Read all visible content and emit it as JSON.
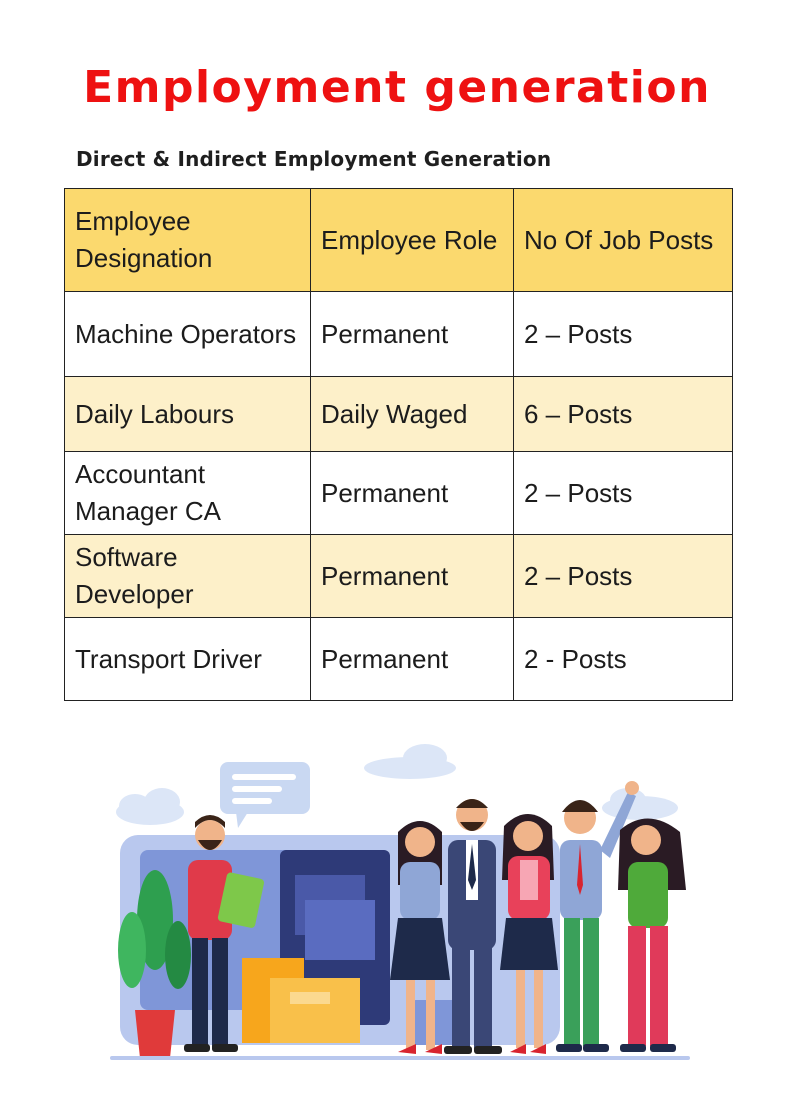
{
  "title": "Employment generation",
  "subtitle": "Direct & Indirect Employment Generation",
  "table": {
    "headers": [
      "Employee Designation",
      "Employee Role",
      "No Of Job Posts"
    ],
    "rows": [
      [
        "Machine Operators",
        "Permanent",
        "2 – Posts"
      ],
      [
        "Daily Labours",
        "Daily Waged",
        "6 – Posts"
      ],
      [
        "Accountant Manager CA",
        "Permanent",
        "2 – Posts"
      ],
      [
        "Software Developer",
        "Permanent",
        "2 – Posts"
      ],
      [
        "Transport Driver",
        "Permanent",
        "2 - Posts"
      ]
    ]
  },
  "colors": {
    "title": "#ee1111",
    "header_bg": "#fbd96e",
    "alt_row_bg": "#fdf0c9"
  },
  "illustration": "team-of-employees-illustration"
}
